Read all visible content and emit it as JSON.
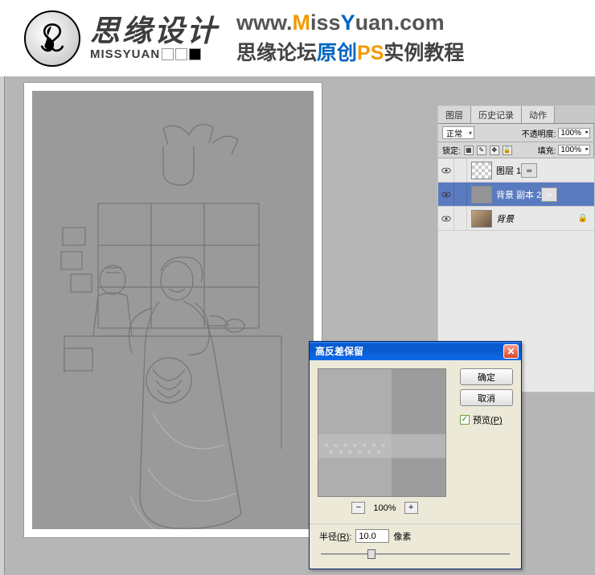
{
  "header": {
    "brand_main": "思缘设计",
    "brand_sub": "MISSYUAN",
    "url_www": "www.",
    "url_M": "M",
    "url_iss": "iss",
    "url_Y": "Y",
    "url_uan": "uan",
    "url_com": ".com",
    "subtitle_a": "思缘论坛",
    "subtitle_b": "原创",
    "subtitle_c": "PS",
    "subtitle_d": "实例教程"
  },
  "layers_panel": {
    "tabs": {
      "layers": "图层",
      "history": "历史记录",
      "actions": "动作"
    },
    "blend_mode": "正常",
    "opacity_label": "不透明度:",
    "opacity_value": "100%",
    "lock_label": "锁定:",
    "fill_label": "填充:",
    "fill_value": "100%",
    "link_icon_label": "∞",
    "layers": [
      {
        "name": "图层 1"
      },
      {
        "name": "背景 副本 2"
      },
      {
        "name": "背景"
      }
    ]
  },
  "dialog": {
    "title": "高反差保留",
    "ok": "确定",
    "cancel": "取消",
    "preview_chk": "预览",
    "preview_key": "(P)",
    "zoom": "100%",
    "minus": "−",
    "plus": "+",
    "radius_label": "半径",
    "radius_key": "(R)",
    "radius_value": "10.0",
    "radius_unit": "像素"
  }
}
